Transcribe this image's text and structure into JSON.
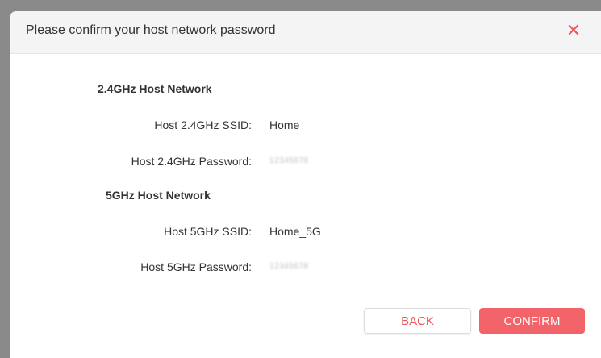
{
  "dialog": {
    "title": "Please confirm your host network password",
    "close_icon": "close-icon"
  },
  "sections": {
    "band24": {
      "title": "2.4GHz Host Network",
      "ssid_label": "Host 2.4GHz SSID:",
      "ssid_value": "Home",
      "password_label": "Host 2.4GHz Password:",
      "password_value": "12345678"
    },
    "band5": {
      "title": "5GHz Host Network",
      "ssid_label": "Host 5GHz SSID:",
      "ssid_value": "Home_5G",
      "password_label": "Host 5GHz Password:",
      "password_value": "12345678"
    }
  },
  "buttons": {
    "back_label": "BACK",
    "confirm_label": "CONFIRM"
  },
  "colors": {
    "accent": "#f3646a",
    "close": "#f0555a"
  }
}
